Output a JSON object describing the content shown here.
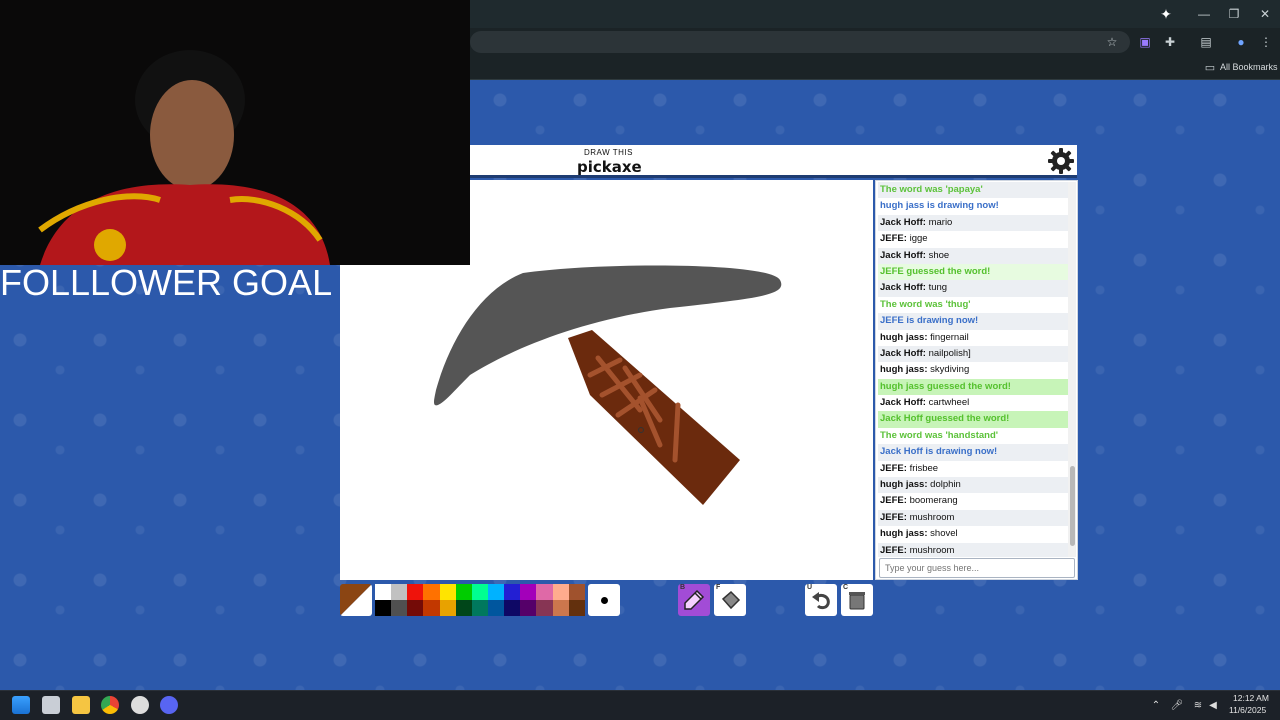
{
  "browser": {
    "bookmarks_label": "All Bookmarks",
    "icons": [
      "sparkle-icon",
      "minimize-icon",
      "restore-icon",
      "close-icon",
      "star-icon",
      "extension-icon",
      "puzzle-icon",
      "sidepanel-icon",
      "profile-icon",
      "menu-icon",
      "folder-icon"
    ]
  },
  "game": {
    "draw_hint": "DRAW THIS",
    "word": "pickaxe",
    "settings_icon": "gear-icon",
    "chat": [
      {
        "type": "sys-green",
        "text": "The word was 'papaya'"
      },
      {
        "type": "sys-blue",
        "text": "hugh jass is drawing now!"
      },
      {
        "type": "msg",
        "user": "Jack Hoff:",
        "text": " mario"
      },
      {
        "type": "msg",
        "user": "JEFE:",
        "text": " igge"
      },
      {
        "type": "msg",
        "user": "Jack Hoff:",
        "text": " shoe"
      },
      {
        "type": "sys-guess2",
        "text": "JEFE guessed the word!"
      },
      {
        "type": "msg",
        "user": "Jack Hoff:",
        "text": " tung"
      },
      {
        "type": "sys-green",
        "text": "The word was 'thug'"
      },
      {
        "type": "sys-blue",
        "text": "JEFE is drawing now!"
      },
      {
        "type": "msg",
        "user": "hugh jass:",
        "text": " fingernail"
      },
      {
        "type": "msg",
        "user": "Jack Hoff:",
        "text": " nailpolish]"
      },
      {
        "type": "msg",
        "user": "hugh jass:",
        "text": " skydiving"
      },
      {
        "type": "sys-guess",
        "text": "hugh jass guessed the word!"
      },
      {
        "type": "msg",
        "user": "Jack Hoff:",
        "text": " cartwheel"
      },
      {
        "type": "sys-guess",
        "text": "Jack Hoff guessed the word!"
      },
      {
        "type": "sys-green",
        "text": "The word was 'handstand'"
      },
      {
        "type": "sys-blue",
        "text": "Jack Hoff is drawing now!"
      },
      {
        "type": "msg",
        "user": "JEFE:",
        "text": " frisbee"
      },
      {
        "type": "msg",
        "user": "hugh jass:",
        "text": " dolphin"
      },
      {
        "type": "msg",
        "user": "JEFE:",
        "text": " boomerang"
      },
      {
        "type": "msg",
        "user": "JEFE:",
        "text": " mushroom"
      },
      {
        "type": "msg",
        "user": "hugh jass:",
        "text": " shovel"
      },
      {
        "type": "msg",
        "user": "JEFE:",
        "text": " mushroom"
      }
    ],
    "guess_placeholder": "Type your guess here...",
    "palette": [
      "#ffffff",
      "#c1c1c1",
      "#ef130b",
      "#ff7100",
      "#ffe400",
      "#00cc00",
      "#00ff91",
      "#00b2ff",
      "#231fd3",
      "#a300ba",
      "#df69a7",
      "#ffac8e",
      "#a0522d",
      "#000000",
      "#505050",
      "#740b07",
      "#c23800",
      "#e8a200",
      "#004619",
      "#00785d",
      "#00569e",
      "#0e0865",
      "#550069",
      "#873554",
      "#cc774d",
      "#63300d"
    ],
    "current_color": "#8b4513",
    "tools": {
      "pen_key": "B",
      "fill_key": "F",
      "undo_key": "U",
      "clear_key": "C"
    }
  },
  "overlay": {
    "follower_text": "FOLLLOWER GOAL"
  },
  "taskbar": {
    "time": "12:12 AM",
    "date": "11/6/2025"
  }
}
